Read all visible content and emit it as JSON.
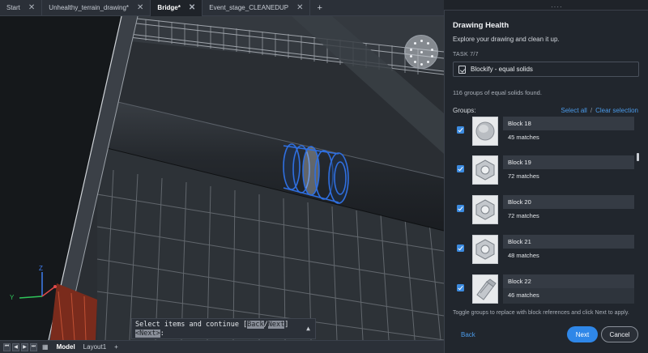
{
  "tabs": [
    {
      "label": "Start",
      "active": false
    },
    {
      "label": "Unhealthy_terrain_drawing*",
      "active": false
    },
    {
      "label": "Bridge*",
      "active": true
    },
    {
      "label": "Event_stage_CLEANEDUP",
      "active": false
    }
  ],
  "tab_close_icon": "close-icon",
  "tab_add_label": "+",
  "command_line": {
    "line1_prefix": "Select items and continue [",
    "opt_back": "Back",
    "slash": "/",
    "opt_next": "Next",
    "line1_suffix": "]",
    "line2_opt": "<Next>",
    "line2_suffix": ":"
  },
  "layout_bar": {
    "nav_first": "⏮",
    "nav_prev": "◀",
    "nav_next": "▶",
    "nav_last": "⏭",
    "grid_icon": "▦",
    "model_label": "Model",
    "layout_label": "Layout1",
    "add_label": "+"
  },
  "axis": {
    "z": "Z",
    "y": "Y"
  },
  "panel": {
    "grip": "····",
    "title": "Drawing Health",
    "subtitle": "Explore your drawing and clean it up.",
    "task_label": "TASK 7/7",
    "task_name": "Blockify - equal solids",
    "found_text": "116 groups of equal solids found.",
    "groups_label": "Groups:",
    "select_all": "Select all",
    "separator": "/",
    "clear_selection": "Clear selection",
    "groups": [
      {
        "name": "Block 18",
        "matches": "45 matches",
        "shape": "dome"
      },
      {
        "name": "Block 19",
        "matches": "72 matches",
        "shape": "hexnut"
      },
      {
        "name": "Block 20",
        "matches": "72 matches",
        "shape": "hexnut"
      },
      {
        "name": "Block 21",
        "matches": "48 matches",
        "shape": "hexnut"
      },
      {
        "name": "Block 22",
        "matches": "46 matches",
        "shape": "bolt"
      }
    ],
    "help_text": "Toggle groups to replace with block references and click Next to apply.",
    "back_label": "Back",
    "next_label": "Next",
    "cancel_label": "Cancel"
  },
  "colors": {
    "accent": "#2f87e8",
    "link": "#4b9bea",
    "selection": "#2f6fe0",
    "background": "#262a2f"
  }
}
